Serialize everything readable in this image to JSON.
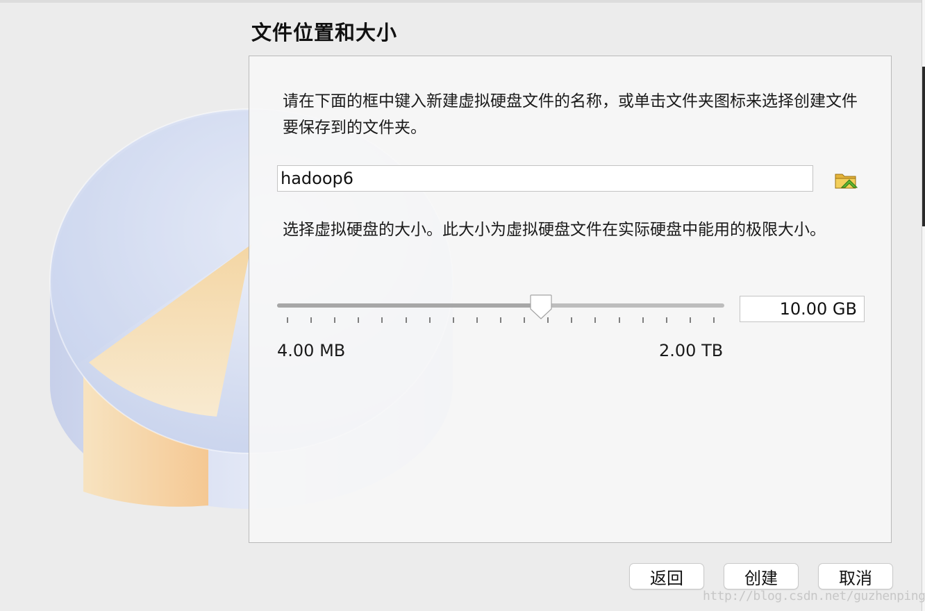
{
  "dialog": {
    "page_title": "文件位置和大小",
    "location_description": "请在下面的框中键入新建虚拟硬盘文件的名称，或单击文件夹图标来选择创建文件要保存到的文件夹。",
    "file_name_value": "hadoop6",
    "folder_icon": "folder-up-arrow-icon",
    "size_description": "选择虚拟硬盘的大小。此大小为虚拟硬盘文件在实际硬盘中能用的极限大小。",
    "size_value": "10.00 GB",
    "slider_fraction": 0.59,
    "slider_tick_count": 19,
    "size_min_label": "4.00 MB",
    "size_max_label": "2.00 TB"
  },
  "buttons": {
    "back_label": "返回",
    "create_label": "创建",
    "cancel_label": "取消"
  },
  "watermark": "http://blog.csdn.net/guzhenping",
  "colors": {
    "disk_body": "#cdd8ef",
    "disk_slice": "#f6d8a8"
  }
}
